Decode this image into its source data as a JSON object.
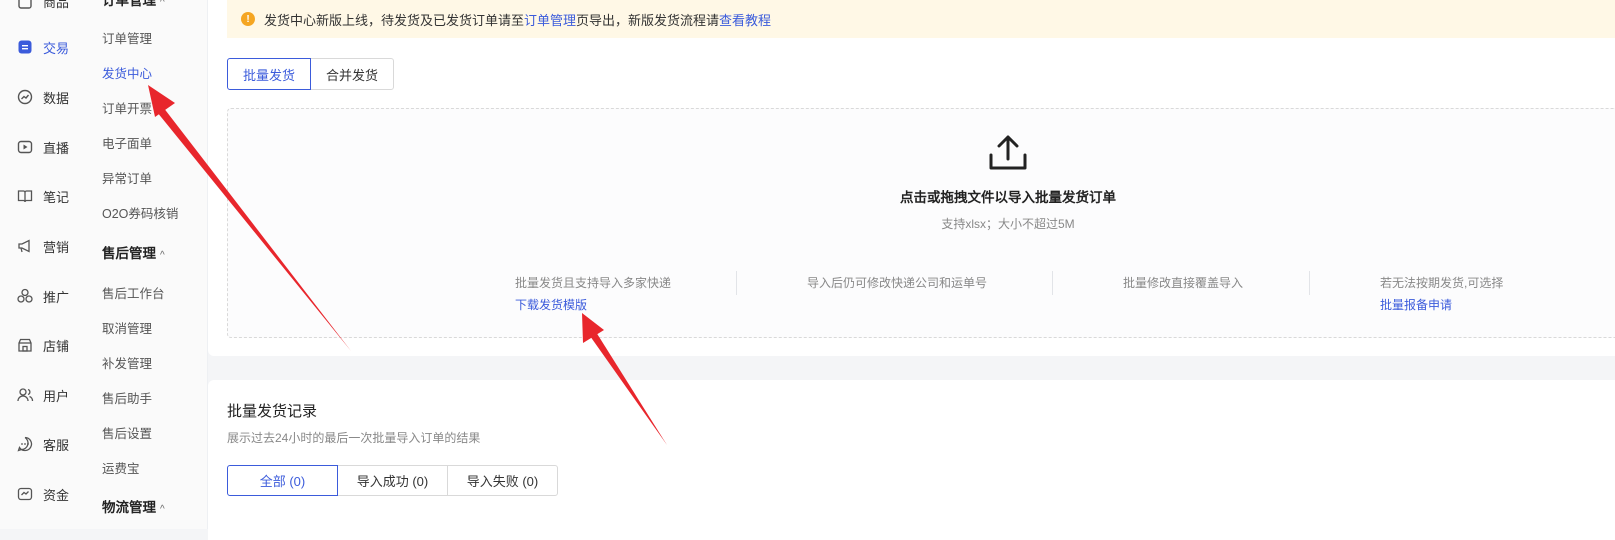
{
  "nav_primary": [
    {
      "label": "商品",
      "icon": "bag-icon"
    },
    {
      "label": "交易",
      "icon": "clipboard-icon",
      "active": true
    },
    {
      "label": "数据",
      "icon": "chart-icon"
    },
    {
      "label": "直播",
      "icon": "play-icon"
    },
    {
      "label": "笔记",
      "icon": "book-icon"
    },
    {
      "label": "营销",
      "icon": "megaphone-icon"
    },
    {
      "label": "推广",
      "icon": "promo-icon"
    },
    {
      "label": "店铺",
      "icon": "shop-icon"
    },
    {
      "label": "用户",
      "icon": "users-icon"
    },
    {
      "label": "客服",
      "icon": "chat-icon"
    },
    {
      "label": "资金",
      "icon": "wallet-icon"
    }
  ],
  "nav_secondary": {
    "top_group": "订单管理",
    "order_items": [
      "订单管理",
      "发货中心",
      "订单开票",
      "电子面单",
      "异常订单",
      "O2O券码核销"
    ],
    "aftersale_group": "售后管理",
    "aftersale_items": [
      "售后工作台",
      "取消管理",
      "补发管理",
      "售后助手",
      "售后设置",
      "运费宝"
    ],
    "logistics_group": "物流管理",
    "caret": "^"
  },
  "notice": {
    "icon": "!",
    "text1": "发货中心新版上线，待发货及已发货订单请至",
    "link1": "订单管理",
    "text2": "页导出，新版发货流程请",
    "link2": "查看教程"
  },
  "tabs": [
    "批量发货",
    "合并发货"
  ],
  "upload": {
    "title": "点击或拖拽文件以导入批量发货订单",
    "subtitle": "支持xlsx；大小不超过5M",
    "features": [
      {
        "text": "批量发货且支持导入多家快递",
        "link": "下载发货模版"
      },
      {
        "text": "导入后仍可修改快递公司和运单号",
        "link": ""
      },
      {
        "text": "批量修改直接覆盖导入",
        "link": ""
      },
      {
        "text": "若无法按期发货,可选择",
        "link": "批量报备申请"
      }
    ]
  },
  "records": {
    "title": "批量发货记录",
    "subtitle": "展示过去24小时的最后一次批量导入订单的结果",
    "filters": [
      "全部 (0)",
      "导入成功 (0)",
      "导入失败 (0)"
    ]
  },
  "colors": {
    "accent": "#3b5bdb",
    "annotation_arrow": "#e8262c",
    "notice_bg": "#fff8e6"
  }
}
